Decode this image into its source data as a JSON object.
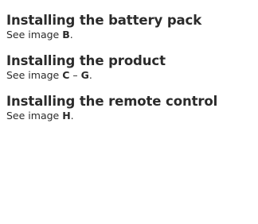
{
  "sections": [
    {
      "title": "Installing the battery pack",
      "desc_prefix": "See image ",
      "ref_start": "B",
      "ref_sep": "",
      "ref_end": "",
      "desc_suffix": "."
    },
    {
      "title": "Installing the product",
      "desc_prefix": "See image ",
      "ref_start": "C",
      "ref_sep": " – ",
      "ref_end": "G",
      "desc_suffix": "."
    },
    {
      "title": "Installing the remote control",
      "desc_prefix": "See image ",
      "ref_start": "H",
      "ref_sep": "",
      "ref_end": "",
      "desc_suffix": "."
    }
  ]
}
